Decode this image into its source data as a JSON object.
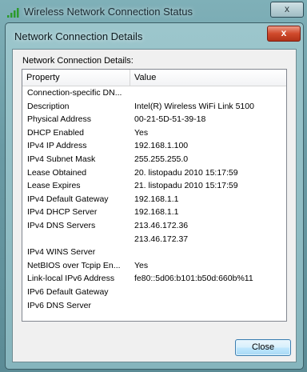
{
  "outer_window": {
    "title": "Wireless Network Connection Status",
    "close_label": "x"
  },
  "dialog": {
    "title": "Network Connection Details",
    "close_label": "x",
    "details_label": "Network Connection Details:",
    "close_button": "Close"
  },
  "table": {
    "headers": {
      "property": "Property",
      "value": "Value"
    },
    "rows": [
      {
        "property": "Connection-specific DN...",
        "value": ""
      },
      {
        "property": "Description",
        "value": "Intel(R) Wireless WiFi Link 5100"
      },
      {
        "property": "Physical Address",
        "value": "00-21-5D-51-39-18"
      },
      {
        "property": "DHCP Enabled",
        "value": "Yes"
      },
      {
        "property": "IPv4 IP Address",
        "value": "192.168.1.100"
      },
      {
        "property": "IPv4 Subnet Mask",
        "value": "255.255.255.0"
      },
      {
        "property": "Lease Obtained",
        "value": "20. listopadu 2010 15:17:59"
      },
      {
        "property": "Lease Expires",
        "value": "21. listopadu 2010 15:17:59"
      },
      {
        "property": "IPv4 Default Gateway",
        "value": "192.168.1.1"
      },
      {
        "property": "IPv4 DHCP Server",
        "value": "192.168.1.1"
      },
      {
        "property": "IPv4 DNS Servers",
        "value": "213.46.172.36"
      },
      {
        "property": "",
        "value": "213.46.172.37"
      },
      {
        "property": "IPv4 WINS Server",
        "value": ""
      },
      {
        "property": "NetBIOS over Tcpip En...",
        "value": "Yes"
      },
      {
        "property": "Link-local IPv6 Address",
        "value": "fe80::5d06:b101:b50d:660b%11"
      },
      {
        "property": "IPv6 Default Gateway",
        "value": ""
      },
      {
        "property": "IPv6 DNS Server",
        "value": ""
      }
    ]
  },
  "icons": {
    "wifi": "wifi-signal-icon"
  }
}
